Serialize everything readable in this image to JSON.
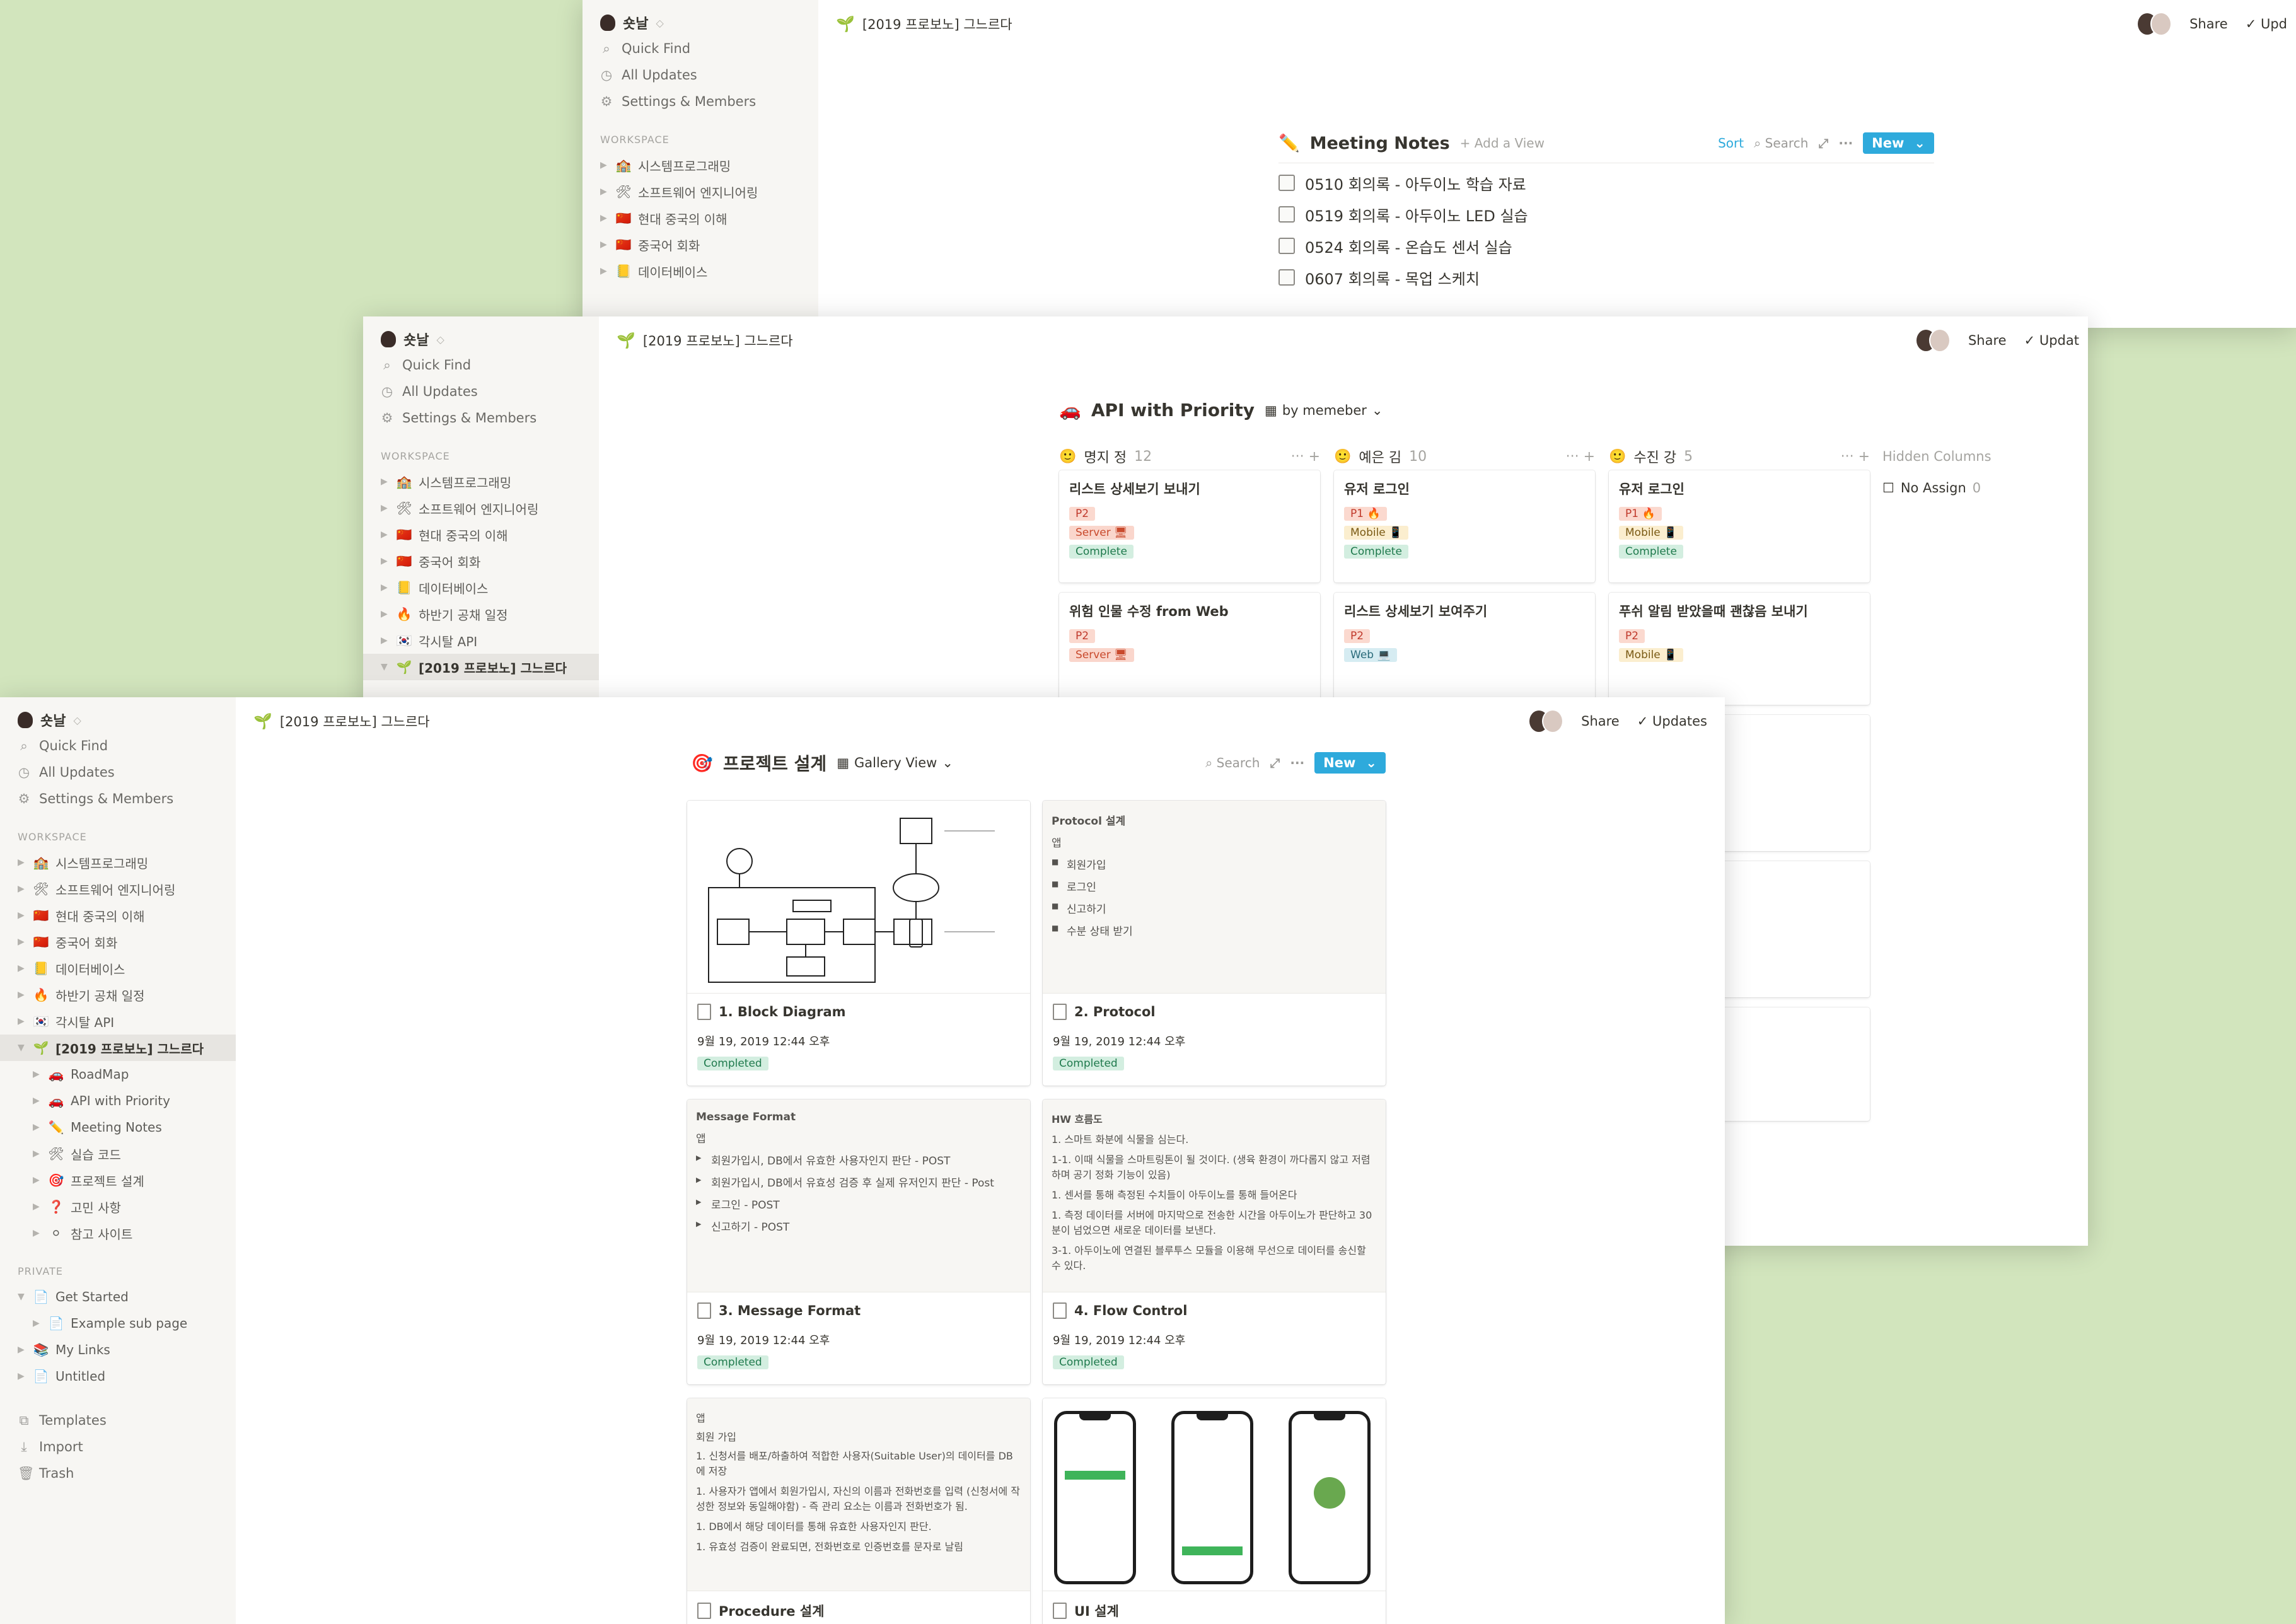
{
  "common": {
    "workspace": "숏날",
    "nav": [
      "Quick Find",
      "All Updates",
      "Settings & Members"
    ],
    "workspace_section": "WORKSPACE",
    "breadcrumb": "[2019 프로보노] 그느르다",
    "share": "Share",
    "updates": "Updates",
    "updates_short": "Updat",
    "updates_short2": "Upd"
  },
  "sidebar_items": [
    {
      "emoji": "🏫",
      "label": "시스템프로그래밍"
    },
    {
      "emoji": "🛠",
      "label": "소프트웨어 엔지니어링"
    },
    {
      "emoji": "🇨🇳",
      "label": "현대 중국의 이해"
    },
    {
      "emoji": "🇨🇳",
      "label": "중국어 회화"
    },
    {
      "emoji": "📒",
      "label": "데이터베이스"
    },
    {
      "emoji": "🔥",
      "label": "하반기 공채 일정"
    },
    {
      "emoji": "🇰🇷",
      "label": "각시탈 API"
    },
    {
      "emoji": "🌱",
      "label": "[2019 프로보노] 그느르다"
    }
  ],
  "sidebar_sub": [
    {
      "emoji": "🚗",
      "label": "RoadMap"
    },
    {
      "emoji": "🚗",
      "label": "API with Priority"
    },
    {
      "emoji": "✏️",
      "label": "Meeting Notes"
    },
    {
      "emoji": "🛠",
      "label": "실습 코드"
    },
    {
      "emoji": "🎯",
      "label": "프로젝트 설계"
    },
    {
      "emoji": "❓",
      "label": "고민 사항"
    },
    {
      "emoji": "⚪",
      "label": "참고 사이트"
    }
  ],
  "private_section": "PRIVATE",
  "private_items": [
    {
      "emoji": "📄",
      "label": "Get Started"
    },
    {
      "emoji": "📄",
      "label": "Example sub page"
    },
    {
      "emoji": "📚",
      "label": "My Links"
    },
    {
      "emoji": "📄",
      "label": "Untitled"
    }
  ],
  "bottom_nav": [
    "Templates",
    "Import",
    "Trash"
  ],
  "meeting": {
    "title": "Meeting Notes",
    "add_view": "+ Add a View",
    "sort": "Sort",
    "search": "Search",
    "new": "New",
    "rows": [
      "0510 회의록 - 아두이노 학습 자료",
      "0519 회의록 - 아두이노 LED 실습",
      "0524 회의록 - 온습도 센서 실습",
      "0607 회의록 - 목업 스케치"
    ]
  },
  "board": {
    "title": "API with Priority",
    "view": "by memeber",
    "hidden_columns": "Hidden Columns",
    "no_assign": "No Assign",
    "no_assign_count": "0",
    "columns": [
      {
        "name": "명지 정",
        "count": "12",
        "cards": [
          {
            "title": "리스트 상세보기 보내기",
            "tags": [
              "P2",
              "Server 🖥",
              "Complete"
            ]
          },
          {
            "title": "위험 인물 수정 from Web",
            "tags": [
              "P2",
              "Server 🖥"
            ]
          }
        ]
      },
      {
        "name": "예은 김",
        "count": "10",
        "cards": [
          {
            "title": "유저 로그인",
            "tags": [
              "P1 🔥",
              "Mobile 📱",
              "Complete"
            ]
          },
          {
            "title": "리스트 상세보기 보여주기",
            "tags": [
              "P2",
              "Web 💻"
            ]
          }
        ]
      },
      {
        "name": "수진 강",
        "count": "5",
        "cards": [
          {
            "title": "유저 로그인",
            "tags": [
              "P1 🔥",
              "Mobile 📱",
              "Complete"
            ]
          },
          {
            "title": "푸쉬 알림 받았을때 괜찮음 보내기",
            "tags": [
              "P2",
              "Mobile 📱"
            ]
          }
        ]
      }
    ]
  },
  "gallery": {
    "title": "프로젝트 설계",
    "view": "Gallery View",
    "search": "Search",
    "new": "New",
    "date": "9월 19, 2019 12:44 오후",
    "status": "Completed",
    "cards": [
      {
        "title": "1. Block Diagram"
      },
      {
        "title": "2. Protocol",
        "preview_title": "Protocol 설계",
        "preview_sub": "앱",
        "items": [
          "회원가입",
          "로그인",
          "신고하기",
          "수분 상태 받기"
        ]
      },
      {
        "title": "3. Message Format",
        "preview_title": "Message Format",
        "preview_sub": "앱",
        "items": [
          "회원가입시, DB에서 유효한 사용자인지 판단 - POST",
          "회원가입시, DB에서 유효성 검증 후 실제 유저인지 판단 - Post",
          "로그인 - POST",
          "신고하기 - POST"
        ]
      },
      {
        "title": "4. Flow Control",
        "preview_title": "HW 흐름도",
        "lines": [
          "1. 스마트 화분에 식물을 심는다.",
          "1-1. 이때 식물을 스마트링톤이 될 것이다. (생육 환경이 까다롭지 않고 저렴하며 공기 정화 기능이 있음)",
          "1. 센서를 통해 측정된 수치들이 아두이노를 통해 들어온다",
          "1. 측정 데이터를 서버에 마지막으로 전송한 시간을 아두이노가 판단하고 30분이 넘었으면 새로운 데이터를 보낸다.",
          "3-1. 아두이노에 연결된 블루투스 모듈을 이용해 무선으로 데이터를 송신할 수 있다."
        ]
      },
      {
        "title": "Procedure 설계",
        "preview_title": "앱",
        "preview_sub": "회원 가입",
        "lines": [
          "1. 신청서를 배포/하출하여 적합한 사용자(Suitable User)의 데이터를 DB에 저장",
          "1. 사용자가 앱에서 회원가입시, 자신의 이름과 전화번호를 입력 (신청서에 작성한 정보와 동일해야함) - 즉 관리 요소는 이름과 전화번호가 됨.",
          "1. DB에서 해당 데이터를 통해 유효한 사용자인지 판단.",
          "1. 유효성 검증이 완료되면, 전화번호로 인증번호를 문자로 날림"
        ]
      },
      {
        "title": "UI 설계"
      }
    ]
  }
}
